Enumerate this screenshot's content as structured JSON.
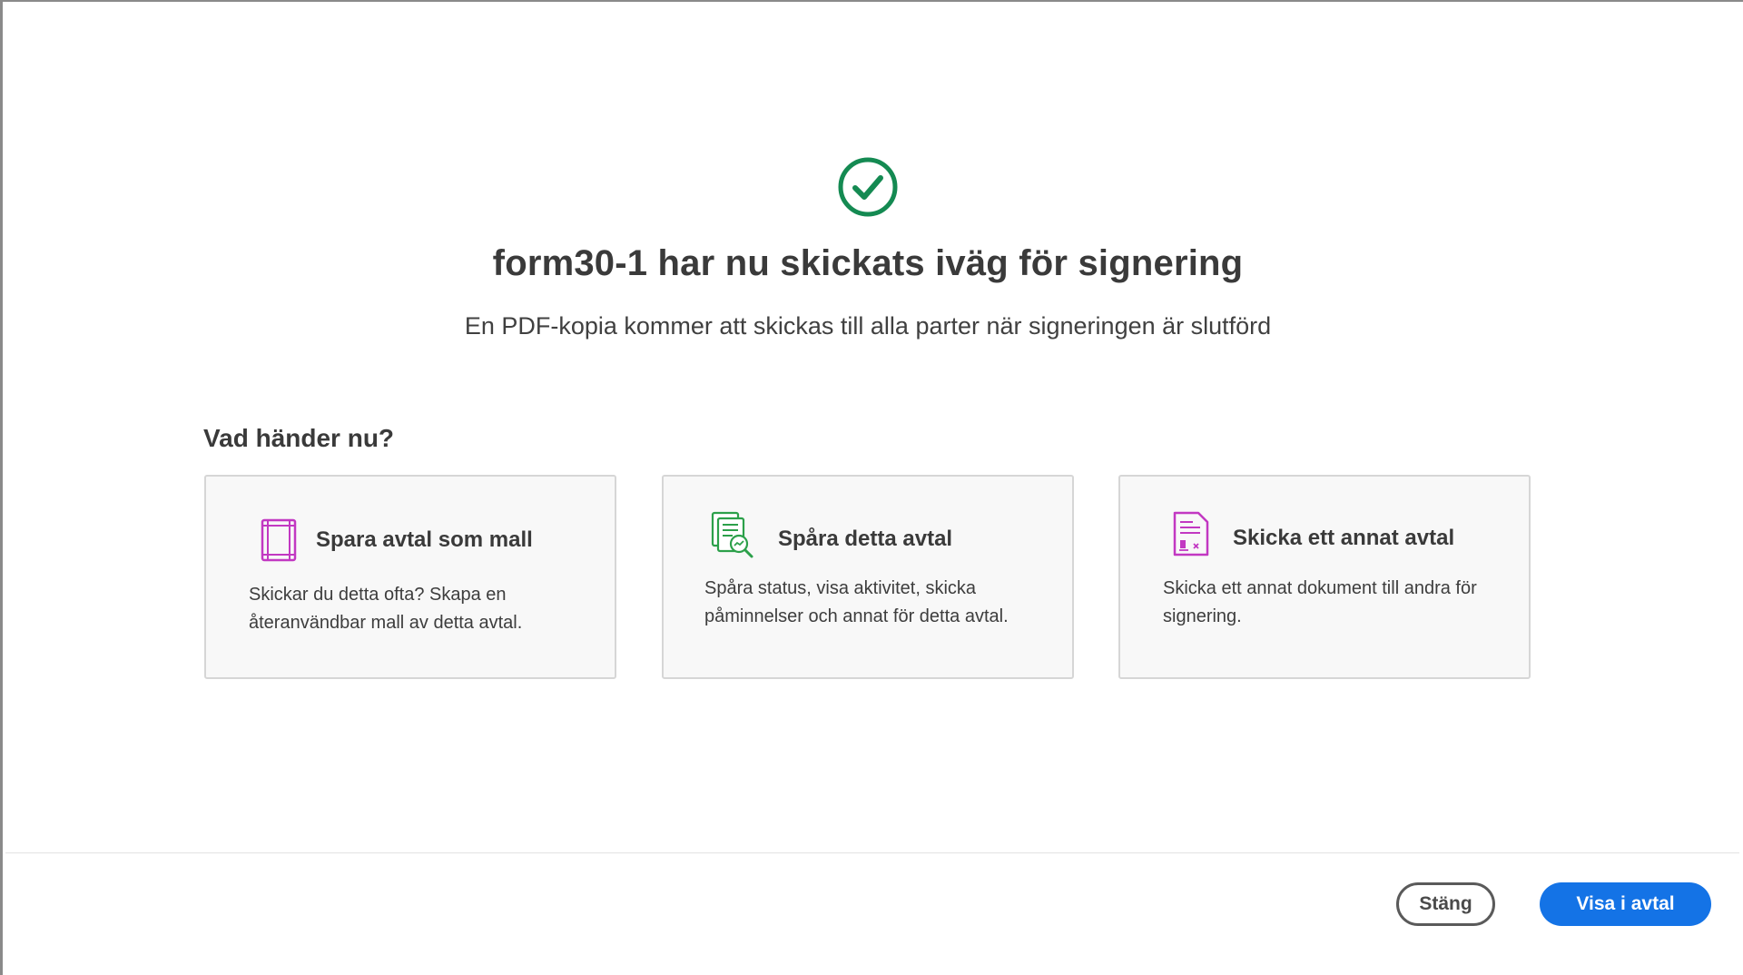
{
  "dialog": {
    "title": "form30-1 har nu skickats iväg för signering",
    "subtitle": "En PDF-kopia kommer att skickas till alla parter när signeringen är slutförd",
    "status_icon": "checkmark-circle-icon"
  },
  "next_steps": {
    "heading": "Vad händer nu?",
    "cards": [
      {
        "icon": "template-icon",
        "title": "Spara avtal som mall",
        "description": "Skickar du detta ofta? Skapa en återanvändbar mall av detta avtal."
      },
      {
        "icon": "track-document-icon",
        "title": "Spåra detta avtal",
        "description": "Spåra status, visa aktivitet, skicka påminnelser och annat för detta avtal."
      },
      {
        "icon": "send-document-icon",
        "title": "Skicka ett annat avtal",
        "description": "Skicka ett annat dokument till andra för signering."
      }
    ]
  },
  "footer": {
    "close_label": "Stäng",
    "view_label": "Visa i avtal"
  },
  "colors": {
    "success_green": "#148a52",
    "template_magenta": "#c238c2",
    "track_green": "#2ca04a",
    "primary_blue": "#1473e6"
  }
}
